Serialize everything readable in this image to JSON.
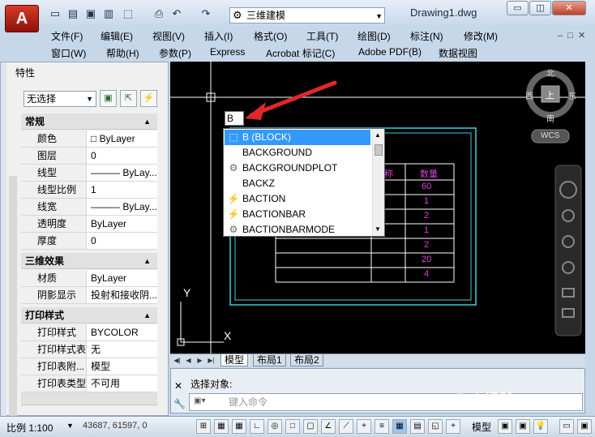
{
  "window": {
    "app_logo": "A",
    "workspace": "三维建模",
    "doc_title": "Drawing1.dwg",
    "minimize_label": "▭",
    "restore_label": "◫",
    "close_label": "✕"
  },
  "menus": {
    "row1": [
      "文件(F)",
      "编辑(E)",
      "视图(V)",
      "插入(I)",
      "格式(O)",
      "工具(T)",
      "绘图(D)",
      "标注(N)",
      "修改(M)"
    ],
    "row2": [
      "窗口(W)",
      "帮助(H)",
      "参数(P)",
      "Express",
      "Acrobat 标记(C)",
      "Adobe PDF(B)",
      "数据视图"
    ]
  },
  "palette": {
    "title": "特性",
    "selection": "无选择",
    "sections": [
      {
        "title": "常规",
        "rows": [
          [
            "颜色",
            "□ ByLayer"
          ],
          [
            "图层",
            "0"
          ],
          [
            "线型",
            "——— ByLay..."
          ],
          [
            "线型比例",
            "1"
          ],
          [
            "线宽",
            "——— ByLay..."
          ],
          [
            "透明度",
            "ByLayer"
          ],
          [
            "厚度",
            "0"
          ]
        ]
      },
      {
        "title": "三维效果",
        "rows": [
          [
            "材质",
            "ByLayer"
          ],
          [
            "阴影显示",
            "投射和接收阴..."
          ]
        ]
      },
      {
        "title": "打印样式",
        "rows": [
          [
            "打印样式",
            "BYCOLOR"
          ],
          [
            "打印样式表",
            "无"
          ],
          [
            "打印表附...",
            "模型"
          ],
          [
            "打印表类型",
            "不可用"
          ]
        ]
      }
    ]
  },
  "viewcube": {
    "north": "北",
    "south": "南",
    "west": "西",
    "east": "东",
    "top": "上",
    "wcs": "WCS"
  },
  "autocomplete": {
    "typed": "B",
    "items": [
      "B (BLOCK)",
      "BACKGROUND",
      "BACKGROUNDPLOT",
      "BACKZ",
      "BACTION",
      "BACTIONBAR",
      "BACTIONBARMODE"
    ],
    "icons": [
      "block-icon",
      "",
      "gear-icon",
      "",
      "lightning-icon",
      "lightning-icon",
      "gear-icon"
    ]
  },
  "table_cells": {
    "col1": [
      "称",
      "",
      "",
      "",
      "",
      "",
      ""
    ],
    "col2": [
      "数量",
      "60",
      "1",
      "2",
      "1",
      "2",
      "20",
      "4"
    ]
  },
  "axes": {
    "y": "Y",
    "x": "X"
  },
  "tabs": [
    "模型",
    "布局1",
    "布局2"
  ],
  "command": {
    "history": "选择对象:",
    "placeholder": "键入命令"
  },
  "status": {
    "scale": "比例 1:100",
    "coords": "43687, 61597, 0",
    "model": "模型"
  },
  "watermark": "Bai 经验"
}
